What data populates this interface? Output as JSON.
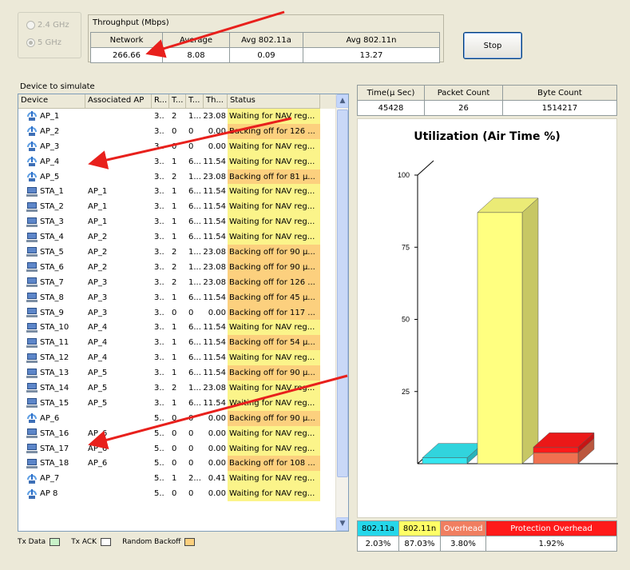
{
  "band": {
    "options": [
      {
        "label": "2.4 GHz",
        "selected": false
      },
      {
        "label": "5 GHz",
        "selected": true
      }
    ]
  },
  "throughput": {
    "title": "Throughput (Mbps)",
    "headers": [
      "Network",
      "Average",
      "Avg 802.11a",
      "Avg 802.11n"
    ],
    "values": [
      "266.66",
      "8.08",
      "0.09",
      "13.27"
    ]
  },
  "stop_label": "Stop",
  "device_list": {
    "title": "Device to simulate",
    "headers": [
      "Device",
      "Associated AP",
      "R...",
      "T...",
      "T...",
      "Th...",
      "Status"
    ],
    "rows": [
      {
        "icon": "ap",
        "device": "AP_1",
        "ap": "",
        "r": "3..",
        "t1": "2",
        "t2": "1...",
        "th": "23.08",
        "status": "Waiting for NAV reg...",
        "st_kind": "wait"
      },
      {
        "icon": "ap",
        "device": "AP_2",
        "ap": "",
        "r": "3..",
        "t1": "0",
        "t2": "0",
        "th": "0.00",
        "status": "Backing off for 126 ...",
        "st_kind": "back"
      },
      {
        "icon": "ap",
        "device": "AP_3",
        "ap": "",
        "r": "3..",
        "t1": "0",
        "t2": "0",
        "th": "0.00",
        "status": "Waiting for NAV reg...",
        "st_kind": "wait"
      },
      {
        "icon": "ap",
        "device": "AP_4",
        "ap": "",
        "r": "3..",
        "t1": "1",
        "t2": "6...",
        "th": "11.54",
        "status": "Waiting for NAV reg...",
        "st_kind": "wait"
      },
      {
        "icon": "ap",
        "device": "AP_5",
        "ap": "",
        "r": "3..",
        "t1": "2",
        "t2": "1...",
        "th": "23.08",
        "status": "Backing off for 81 µ...",
        "st_kind": "back"
      },
      {
        "icon": "sta",
        "device": "STA_1",
        "ap": "AP_1",
        "r": "3..",
        "t1": "1",
        "t2": "6...",
        "th": "11.54",
        "status": "Waiting for NAV reg...",
        "st_kind": "wait"
      },
      {
        "icon": "sta",
        "device": "STA_2",
        "ap": "AP_1",
        "r": "3..",
        "t1": "1",
        "t2": "6...",
        "th": "11.54",
        "status": "Waiting for NAV reg...",
        "st_kind": "wait"
      },
      {
        "icon": "sta",
        "device": "STA_3",
        "ap": "AP_1",
        "r": "3..",
        "t1": "1",
        "t2": "6...",
        "th": "11.54",
        "status": "Waiting for NAV reg...",
        "st_kind": "wait"
      },
      {
        "icon": "sta",
        "device": "STA_4",
        "ap": "AP_2",
        "r": "3..",
        "t1": "1",
        "t2": "6...",
        "th": "11.54",
        "status": "Waiting for NAV reg...",
        "st_kind": "wait"
      },
      {
        "icon": "sta",
        "device": "STA_5",
        "ap": "AP_2",
        "r": "3..",
        "t1": "2",
        "t2": "1...",
        "th": "23.08",
        "status": "Backing off for 90 µ...",
        "st_kind": "back"
      },
      {
        "icon": "sta",
        "device": "STA_6",
        "ap": "AP_2",
        "r": "3..",
        "t1": "2",
        "t2": "1...",
        "th": "23.08",
        "status": "Backing off for 90 µ...",
        "st_kind": "back"
      },
      {
        "icon": "sta",
        "device": "STA_7",
        "ap": "AP_3",
        "r": "3..",
        "t1": "2",
        "t2": "1...",
        "th": "23.08",
        "status": "Backing off for 126 ...",
        "st_kind": "back"
      },
      {
        "icon": "sta",
        "device": "STA_8",
        "ap": "AP_3",
        "r": "3..",
        "t1": "1",
        "t2": "6...",
        "th": "11.54",
        "status": "Backing off for 45 µ...",
        "st_kind": "back"
      },
      {
        "icon": "sta",
        "device": "STA_9",
        "ap": "AP_3",
        "r": "3..",
        "t1": "0",
        "t2": "0",
        "th": "0.00",
        "status": "Backing off for 117 ...",
        "st_kind": "back"
      },
      {
        "icon": "sta",
        "device": "STA_10",
        "ap": "AP_4",
        "r": "3..",
        "t1": "1",
        "t2": "6...",
        "th": "11.54",
        "status": "Waiting for NAV reg...",
        "st_kind": "wait"
      },
      {
        "icon": "sta",
        "device": "STA_11",
        "ap": "AP_4",
        "r": "3..",
        "t1": "1",
        "t2": "6...",
        "th": "11.54",
        "status": "Backing off for 54 µ...",
        "st_kind": "back"
      },
      {
        "icon": "sta",
        "device": "STA_12",
        "ap": "AP_4",
        "r": "3..",
        "t1": "1",
        "t2": "6...",
        "th": "11.54",
        "status": "Waiting for NAV reg...",
        "st_kind": "wait"
      },
      {
        "icon": "sta",
        "device": "STA_13",
        "ap": "AP_5",
        "r": "3..",
        "t1": "1",
        "t2": "6...",
        "th": "11.54",
        "status": "Backing off for 90 µ...",
        "st_kind": "back"
      },
      {
        "icon": "sta",
        "device": "STA_14",
        "ap": "AP_5",
        "r": "3..",
        "t1": "2",
        "t2": "1...",
        "th": "23.08",
        "status": "Waiting for NAV reg...",
        "st_kind": "wait"
      },
      {
        "icon": "sta",
        "device": "STA_15",
        "ap": "AP_5",
        "r": "3..",
        "t1": "1",
        "t2": "6...",
        "th": "11.54",
        "status": "Waiting for NAV reg...",
        "st_kind": "wait"
      },
      {
        "icon": "ap",
        "device": "AP_6",
        "ap": "",
        "r": "5..",
        "t1": "0",
        "t2": "0",
        "th": "0.00",
        "status": "Backing off for 90 µ...",
        "st_kind": "back"
      },
      {
        "icon": "sta",
        "device": "STA_16",
        "ap": "AP_6",
        "r": "5..",
        "t1": "0",
        "t2": "0",
        "th": "0.00",
        "status": "Waiting for NAV reg...",
        "st_kind": "wait"
      },
      {
        "icon": "sta",
        "device": "STA_17",
        "ap": "AP_6",
        "r": "5..",
        "t1": "0",
        "t2": "0",
        "th": "0.00",
        "status": "Waiting for NAV reg...",
        "st_kind": "wait"
      },
      {
        "icon": "sta",
        "device": "STA_18",
        "ap": "AP_6",
        "r": "5..",
        "t1": "0",
        "t2": "0",
        "th": "0.00",
        "status": "Backing off for 108 ...",
        "st_kind": "back"
      },
      {
        "icon": "ap",
        "device": "AP_7",
        "ap": "",
        "r": "5..",
        "t1": "1",
        "t2": "2...",
        "th": "0.41",
        "status": "Waiting for NAV reg...",
        "st_kind": "wait"
      },
      {
        "icon": "ap",
        "device": "AP 8",
        "ap": "",
        "r": "5..",
        "t1": "0",
        "t2": "0",
        "th": "0.00",
        "status": "Waiting for NAV reg...",
        "st_kind": "wait"
      }
    ]
  },
  "legend": [
    {
      "label": "Tx Data",
      "color": "#c8f2c8"
    },
    {
      "label": "Tx ACK",
      "color": "#ffffff"
    },
    {
      "label": "Random Backoff",
      "color": "#fcd07e"
    }
  ],
  "status_colors": {
    "wait": "#fbf48a",
    "back": "#fcd07e"
  },
  "stats": {
    "headers": [
      "Time(µ Sec)",
      "Packet Count",
      "Byte Count"
    ],
    "values": [
      "45428",
      "26",
      "1514217"
    ]
  },
  "chart_data": {
    "type": "bar",
    "title": "Utilization (Air Time %)",
    "categories": [
      "802.11a",
      "802.11n",
      "Overhead",
      "Protection Overhead"
    ],
    "series": [
      {
        "values": [
          2.03,
          87.03,
          3.8,
          1.92
        ],
        "colors": [
          "#35e6f0",
          "#ffff80",
          "#f07050",
          "#ff1a1a"
        ]
      }
    ],
    "stacked_last_two": true,
    "yticks": [
      "100",
      "75",
      "50",
      "25"
    ],
    "ylim": [
      0,
      100
    ]
  },
  "utilization_table": {
    "labels": [
      "802.11a",
      "802.11n",
      "Overhead",
      "Protection Overhead"
    ],
    "values": [
      "2.03%",
      "87.03%",
      "3.80%",
      "1.92%"
    ],
    "colors": [
      "#25d7ea",
      "#ffff66",
      "#f07e60",
      "#ff1a1a"
    ]
  }
}
